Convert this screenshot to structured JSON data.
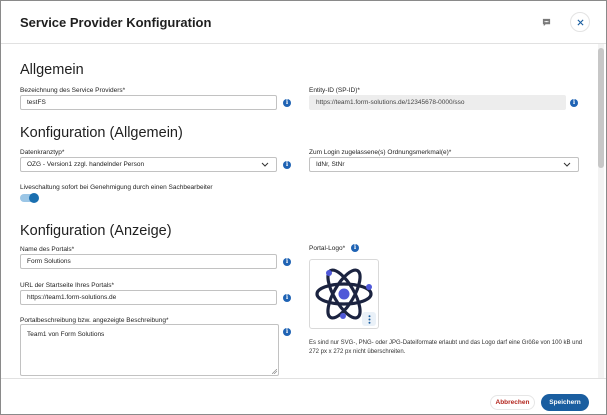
{
  "dialog": {
    "title": "Service Provider Konfiguration",
    "icons": {
      "chat": "chat-bubble-icon",
      "close": "close-icon"
    }
  },
  "sections": {
    "allgemein": {
      "title": "Allgemein",
      "name_label": "Bezeichnung des Service Providers*",
      "name_value": "testFS",
      "entity_label": "Entity-ID (SP-ID)*",
      "entity_value": "https://team1.form-solutions.de/12345678-0000/sso"
    },
    "konfig_allgemein": {
      "title": "Konfiguration (Allgemein)",
      "datenkranz_label": "Datenkranztyp*",
      "datenkranz_value": "OZG - Version1 zzgl. handelnder Person",
      "login_label": "Zum Login zugelassene(s) Ordnungsmerkmal(e)*",
      "login_value": "IdNr, StNr",
      "live_label": "Liveschaltung sofort bei Genehmigung durch einen Sachbearbeiter",
      "live_enabled": true
    },
    "konfig_anzeige": {
      "title": "Konfiguration (Anzeige)",
      "portal_name_label": "Name des Portals*",
      "portal_name_value": "Form Solutions",
      "url_label": "URL der Startseite Ihres Portals*",
      "url_value": "https://team1.form-solutions.de",
      "desc_label": "Portalbeschreibung bzw. angezeigte Beschreibung*",
      "desc_value": "Team1 von Form Solutions",
      "logo_label": "Portal-Logo*",
      "logo_note": "Es sind nur SVG-, PNG- oder JPG-Dateiformate erlaubt und das Logo darf eine Größe von 100 kB und 272 px x 272 px nicht überschreiten."
    }
  },
  "footer": {
    "cancel": "Abbrechen",
    "save": "Speichern"
  },
  "colors": {
    "accent": "#1a5ea0",
    "info": "#1f63b4",
    "danger": "#b3261e",
    "logo_dark": "#1b2340",
    "logo_blue": "#4f58d8"
  },
  "info_glyph": "i"
}
